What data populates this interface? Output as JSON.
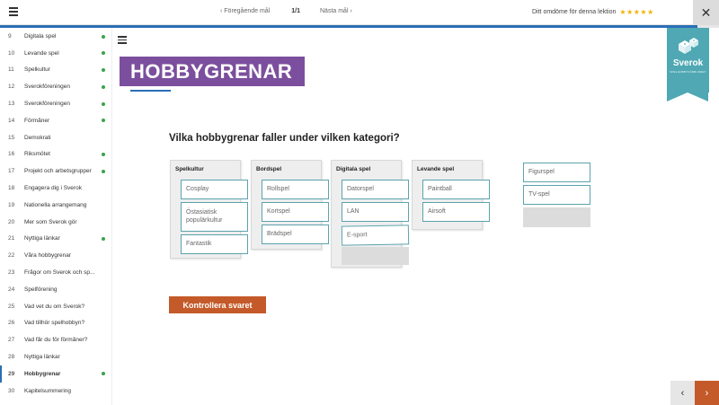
{
  "topbar": {
    "prev_label": "‹ Föregående mål",
    "page_indicator": "1/1",
    "next_label": "Nästa mål ›",
    "rating_label": "Ditt omdöme för denna lektion",
    "stars": "★★★★★",
    "close_symbol": "✕",
    "progress": 0.97
  },
  "sidebar": {
    "items": [
      {
        "num": "9",
        "label": "Digitala spel",
        "done": true
      },
      {
        "num": "10",
        "label": "Levande spel",
        "done": true
      },
      {
        "num": "11",
        "label": "Spelkultur",
        "done": true
      },
      {
        "num": "12",
        "label": "Sverokföreningen",
        "done": true
      },
      {
        "num": "13",
        "label": "Sverokföreningen",
        "done": true
      },
      {
        "num": "14",
        "label": "Förmåner",
        "done": true
      },
      {
        "num": "15",
        "label": "Demokrati",
        "done": false
      },
      {
        "num": "16",
        "label": "Riksmötet",
        "done": true
      },
      {
        "num": "17",
        "label": "Projekt och arbetsgrupper",
        "done": true
      },
      {
        "num": "18",
        "label": "Engagera dig i Sverok",
        "done": false
      },
      {
        "num": "19",
        "label": "Nationella arrangemang",
        "done": false
      },
      {
        "num": "20",
        "label": "Mer som Sverok gör",
        "done": false
      },
      {
        "num": "21",
        "label": "Nyttiga länkar",
        "done": true
      },
      {
        "num": "22",
        "label": "Våra hobbygrenar",
        "done": false
      },
      {
        "num": "23",
        "label": "Frågor om Sverok och sp...",
        "done": false
      },
      {
        "num": "24",
        "label": "Spelförening",
        "done": false
      },
      {
        "num": "25",
        "label": "Vad vet du om Sverok?",
        "done": false
      },
      {
        "num": "26",
        "label": "Vad tillhör spelhobbyn?",
        "done": false
      },
      {
        "num": "27",
        "label": "Vad får du för förmåner?",
        "done": false
      },
      {
        "num": "28",
        "label": "Nyttiga länkar",
        "done": false
      },
      {
        "num": "29",
        "label": "Hobbygrenar",
        "done": true,
        "active": true
      },
      {
        "num": "30",
        "label": "Kapitelsummering",
        "done": false
      }
    ]
  },
  "main": {
    "title": "HOBBYGRENAR",
    "question": "Vilka hobbygrenar faller under vilken kategori?",
    "categories": [
      {
        "title": "Spelkultur",
        "items": [
          "Cosplay",
          "Östasiatisk populärkultur",
          "Fantastik"
        ]
      },
      {
        "title": "Bordspel",
        "items": [
          "Rollspel",
          "Kortspel",
          "Brädspel"
        ]
      },
      {
        "title": "Digitala spel",
        "items": [
          "Datorspel",
          "LAN",
          "E-sport"
        ]
      },
      {
        "title": "Levande spel",
        "items": [
          "Paintball",
          "Airsoft"
        ]
      }
    ],
    "pool": [
      "Figurspel",
      "TV-spel"
    ],
    "check_button": "Kontrollera svaret"
  },
  "logo": {
    "brand": "Sverok",
    "sub": "SPELHOBBYFÖRBUNDET"
  },
  "pager": {
    "prev": "‹",
    "next": "›"
  },
  "colors": {
    "title_bg": "#7b4f9d",
    "accent_blue": "#2a6fb5",
    "button_orange": "#c45a2a",
    "logo_teal": "#4fa8b3",
    "chip_border": "#5ba3ad",
    "done_green": "#3aa34a",
    "star_gold": "#f0b400"
  }
}
